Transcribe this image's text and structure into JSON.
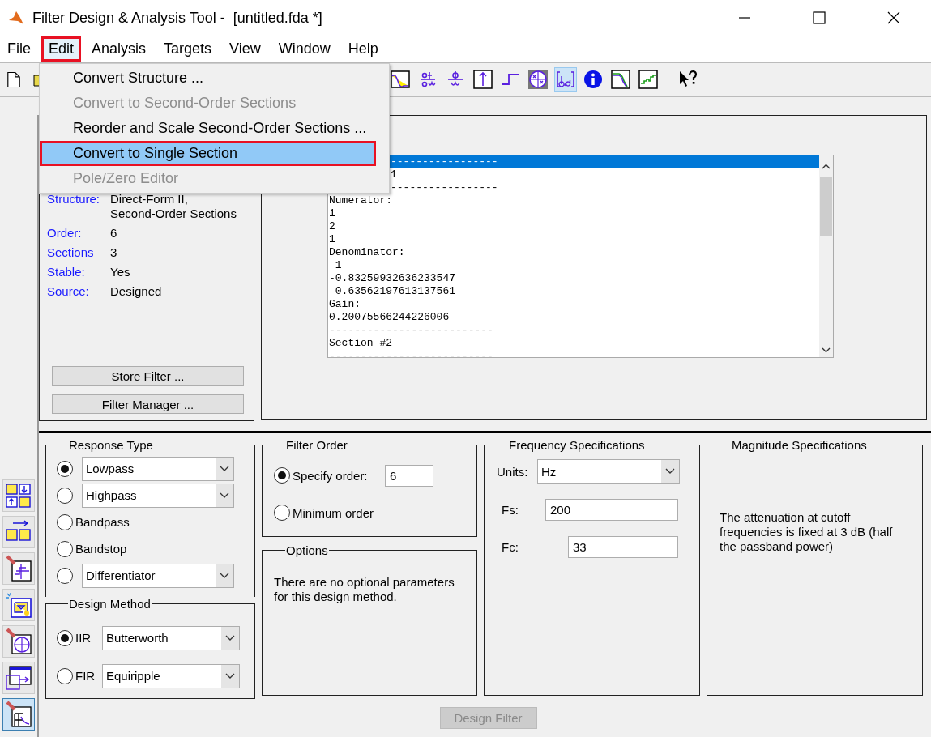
{
  "window": {
    "title": "Filter Design & Analysis Tool -  [untitled.fda *]"
  },
  "menu_bar": [
    {
      "label": "File",
      "selected": false
    },
    {
      "label": "Edit",
      "selected": true
    },
    {
      "label": "Analysis",
      "selected": false
    },
    {
      "label": "Targets",
      "selected": false
    },
    {
      "label": "View",
      "selected": false
    },
    {
      "label": "Window",
      "selected": false
    },
    {
      "label": "Help",
      "selected": false
    }
  ],
  "edit_menu": [
    {
      "label": "Convert Structure ...",
      "disabled": false,
      "selected": false
    },
    {
      "label": "Convert to Second-Order Sections",
      "disabled": true,
      "selected": false
    },
    {
      "label": "Reorder and Scale Second-Order Sections ...",
      "disabled": false,
      "selected": false
    },
    {
      "label": "Convert to Single Section",
      "disabled": false,
      "selected": true
    },
    {
      "label": "Pole/Zero Editor",
      "disabled": true,
      "selected": false
    }
  ],
  "toolbar_file": [
    {
      "kind": "new",
      "selected": false
    },
    {
      "kind": "open",
      "selected": false
    }
  ],
  "toolbar_analysis": [
    {
      "kind": "magnitude",
      "selected": false
    },
    {
      "kind": "group-delay",
      "selected": false
    },
    {
      "kind": "phase-delay",
      "selected": false
    },
    {
      "kind": "impulse",
      "selected": false
    },
    {
      "kind": "step",
      "selected": false
    },
    {
      "kind": "pole-zero",
      "selected": false
    },
    {
      "kind": "coefficients",
      "selected": true
    },
    {
      "kind": "info",
      "selected": false
    },
    {
      "kind": "magnitude-estimate",
      "selected": false
    },
    {
      "kind": "noise",
      "selected": false
    },
    {
      "kind": "whats-this",
      "selected": false
    }
  ],
  "side_buttons": [
    {
      "kind": "transform",
      "selected": false
    },
    {
      "kind": "realize",
      "selected": false
    },
    {
      "kind": "quantize",
      "selected": false
    },
    {
      "kind": "sparkle-diagram",
      "selected": false
    },
    {
      "kind": "pole-zero-edit",
      "selected": false
    },
    {
      "kind": "import",
      "selected": false
    },
    {
      "kind": "design",
      "selected": true
    }
  ],
  "filter_info": {
    "rows": [
      {
        "label": "Structure:",
        "value": "Direct-Form II,\nSecond-Order Sections"
      },
      {
        "label": "Order:",
        "value": "6"
      },
      {
        "label": "Sections",
        "value": "3"
      },
      {
        "label": "Stable:",
        "value": "Yes"
      },
      {
        "label": "Source:",
        "value": "Designed"
      }
    ],
    "buttons": [
      "Store Filter ...",
      "Filter Manager ..."
    ]
  },
  "coefficients": {
    "lines": [
      {
        "text": "-----------------",
        "kind": "partial",
        "selected": true
      },
      {
        "text": "1",
        "kind": "partial",
        "selected": false
      },
      {
        "text": "-----------------",
        "kind": "partial",
        "selected": false
      },
      {
        "text": "Numerator:",
        "kind": "full",
        "selected": false
      },
      {
        "text": "1",
        "kind": "full",
        "selected": false
      },
      {
        "text": "2",
        "kind": "full",
        "selected": false
      },
      {
        "text": "1",
        "kind": "full",
        "selected": false
      },
      {
        "text": "Denominator:",
        "kind": "full",
        "selected": false
      },
      {
        "text": " 1",
        "kind": "full",
        "selected": false
      },
      {
        "text": "-0.83259932636233547",
        "kind": "full",
        "selected": false
      },
      {
        "text": " 0.63562197613137561",
        "kind": "full",
        "selected": false
      },
      {
        "text": "Gain:",
        "kind": "full",
        "selected": false
      },
      {
        "text": "0.20075566244226006",
        "kind": "full",
        "selected": false
      },
      {
        "text": "--------------------------",
        "kind": "full",
        "selected": false
      },
      {
        "text": "Section #2",
        "kind": "full",
        "selected": false
      },
      {
        "text": "--------------------------",
        "kind": "full",
        "selected": false
      }
    ]
  },
  "response_type": {
    "title": "Response Type",
    "options": [
      {
        "label": "Lowpass",
        "kind": "dropdown",
        "selected": true
      },
      {
        "label": "Highpass",
        "kind": "dropdown",
        "selected": false
      },
      {
        "label": "Bandpass",
        "kind": "plain",
        "selected": false
      },
      {
        "label": "Bandstop",
        "kind": "plain",
        "selected": false
      },
      {
        "label": "Differentiator",
        "kind": "dropdown",
        "selected": false
      }
    ]
  },
  "design_method": {
    "title": "Design Method",
    "options": [
      {
        "label": "IIR",
        "value": "Butterworth",
        "selected": true
      },
      {
        "label": "FIR",
        "value": "Equiripple",
        "selected": false
      }
    ]
  },
  "filter_order": {
    "title": "Filter Order",
    "options": [
      {
        "label": "Specify order:",
        "value": "6",
        "selected": true
      },
      {
        "label": "Minimum order",
        "selected": false
      }
    ]
  },
  "options": {
    "title": "Options",
    "text": "There are no optional parameters for this design method."
  },
  "frequency_specifications": {
    "title": "Frequency Specifications",
    "units_label": "Units:",
    "units": "Hz",
    "fields": [
      {
        "label": "Fs:",
        "value": "200"
      },
      {
        "label": "Fc:",
        "value": "33"
      }
    ]
  },
  "magnitude_specifications": {
    "title": "Magnitude Specifications",
    "text": "The attenuation at cutoff frequencies is fixed at 3 dB (half the passband power)"
  },
  "design_button": {
    "label": "Design Filter",
    "disabled": true
  }
}
